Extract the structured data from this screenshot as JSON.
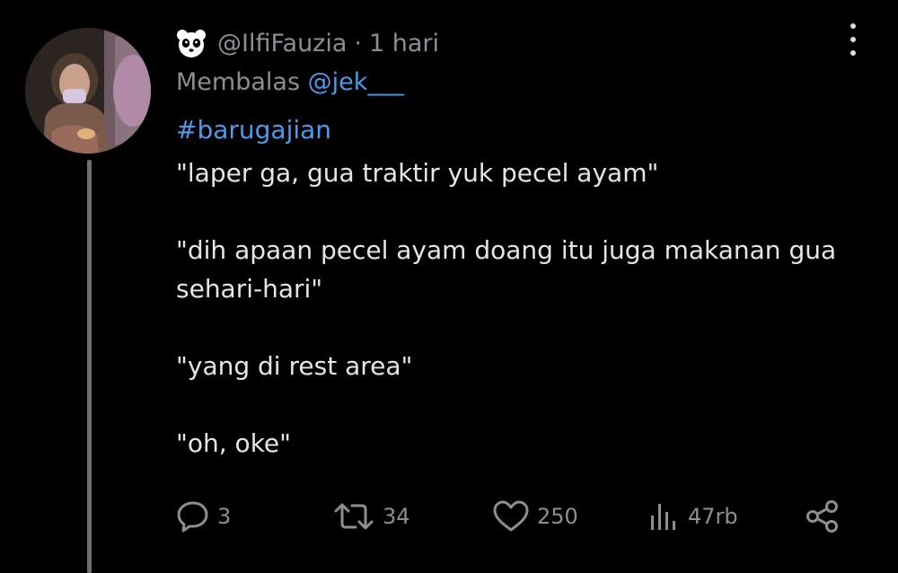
{
  "tweet": {
    "handle": "@IlfiFauzia",
    "separator": "·",
    "time": "1 hari",
    "reply_prefix": "Membalas",
    "reply_to": "@jek___",
    "hashtag": "#barugajian",
    "lines": [
      "\"laper ga, gua traktir yuk pecel ayam\"",
      "\"dih apaan pecel ayam doang itu juga makanan gua sehari-hari\"",
      "\"yang di rest area\"",
      "\"oh, oke\""
    ]
  },
  "actions": {
    "replies": "3",
    "retweets": "34",
    "likes": "250",
    "views": "47rb"
  },
  "icons": {
    "badge": "panda-icon",
    "more": "more-vertical-icon",
    "reply": "reply-icon",
    "retweet": "retweet-icon",
    "like": "heart-icon",
    "views": "views-chart-icon",
    "share": "share-icon"
  },
  "colors": {
    "background": "#000000",
    "text": "#e3e5e7",
    "muted": "#8b8f93",
    "link": "#4c9ae8",
    "thread_line": "#6b6f73"
  }
}
